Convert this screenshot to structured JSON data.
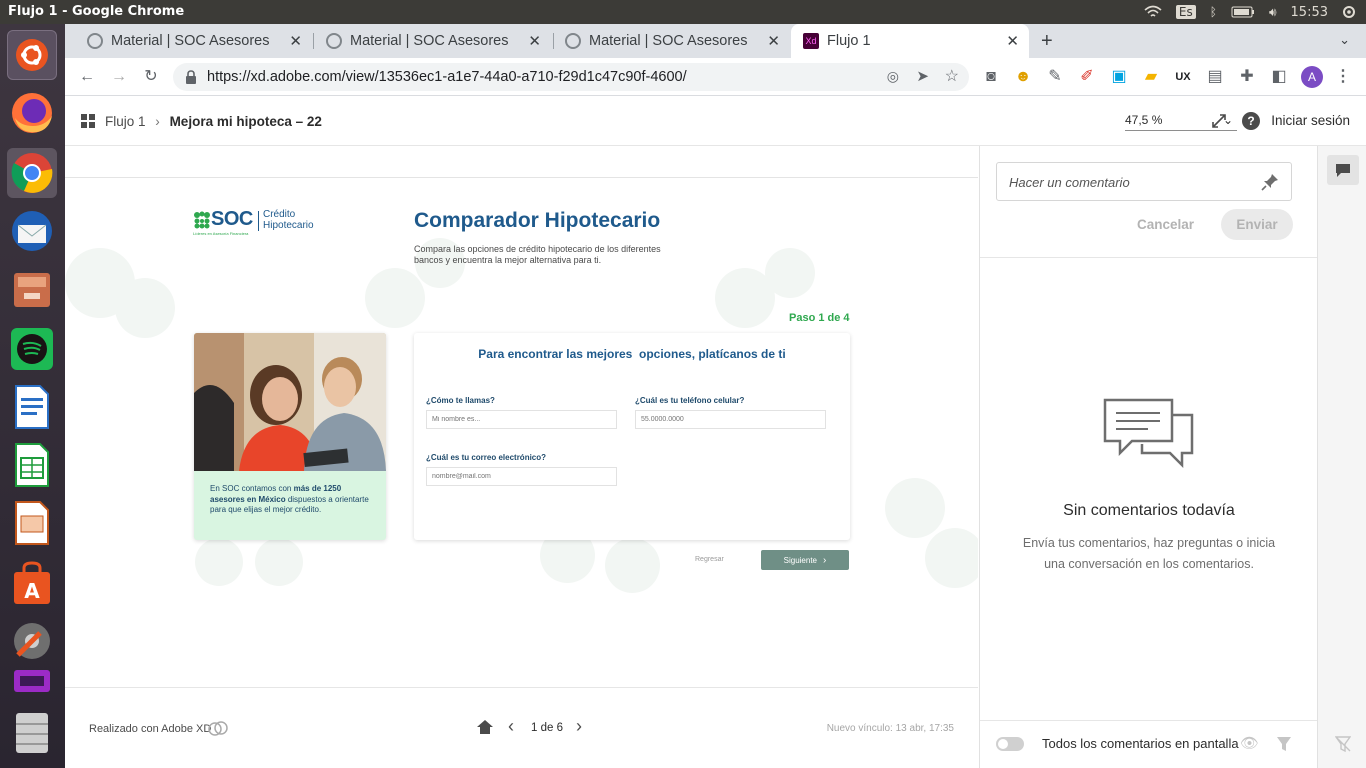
{
  "os": {
    "window_title": "Flujo 1 - Google Chrome",
    "keyboard_layout": "Es",
    "clock": "15:53"
  },
  "browser": {
    "tabs": [
      {
        "label": "Material | SOC Asesores"
      },
      {
        "label": "Material | SOC Asesores"
      },
      {
        "label": "Material | SOC Asesores"
      },
      {
        "label": "Flujo 1",
        "favicon_text": "Xd"
      }
    ],
    "url": "https://xd.adobe.com/view/13536ec1-a1e7-44a0-a710-f29d1c47c90f-4600/",
    "profile_initial": "A"
  },
  "xd": {
    "breadcrumb_root": "Flujo 1",
    "breadcrumb_current": "Mejora mi hipoteca – 22",
    "zoom": "47,5 %",
    "sign_in": "Iniciar sesión",
    "footer_made_with": "Realizado con Adobe XD",
    "page_indicator": "1 de 6",
    "new_link": "Nuevo vínculo: 13 abr, 17:35"
  },
  "design": {
    "logo_main": "SOC",
    "logo_sub1": "Crédito",
    "logo_sub2": "Hipotecario",
    "logo_tagline": "Líderes en Asesoría Financiera",
    "title": "Comparador Hipotecario",
    "subtitle_line1": "Compara las opciones de crédito hipotecario de los diferentes",
    "subtitle_line2": "bancos y encuentra la mejor alternativa para ti.",
    "step": "Paso 1 de 4",
    "card_text_pre": "En SOC contamos con ",
    "card_text_bold": "más de 1250 asesores en México",
    "card_text_post": " dispuestos a orientarte para que elijas el mejor crédito.",
    "form_heading": "Para encontrar las mejores  opciones, platícanos de ti",
    "name_label": "¿Cómo te llamas?",
    "name_placeholder": "Mi nombre es...",
    "phone_label": "¿Cuál es tu teléfono celular?",
    "phone_placeholder": "55.0000.0000",
    "email_label": "¿Cuál es tu correo electrónico?",
    "email_placeholder": "nombre@mail.com",
    "back_label": "Regresar",
    "next_label": "Siguiente",
    "colors": {
      "brand_blue": "#1f5a8c",
      "brand_green": "#2fa84f",
      "card_mint": "#d9f5e1",
      "next_button": "#6f8f86"
    }
  },
  "comments": {
    "input_placeholder": "Hacer un comentario",
    "cancel": "Cancelar",
    "send": "Enviar",
    "empty_title": "Sin comentarios todavía",
    "empty_body_line1": "Envía tus comentarios, haz preguntas o inicia",
    "empty_body_line2": "una conversación en los comentarios.",
    "toggle_label": "Todos los comentarios en pantalla"
  }
}
